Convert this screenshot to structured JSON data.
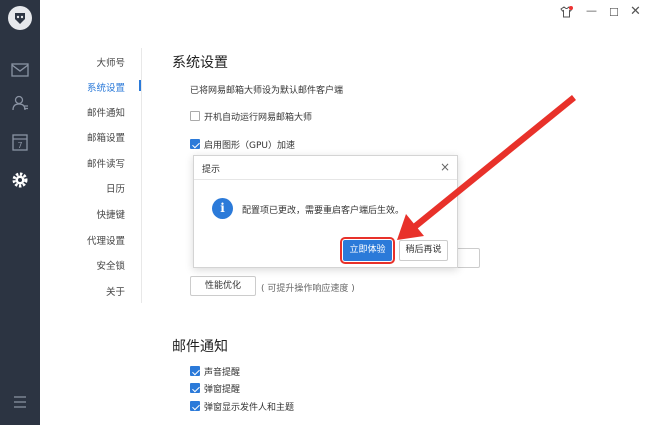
{
  "window_controls": {
    "skin_icon": "shirt-icon",
    "min_label": "—",
    "max_label": "☐",
    "close_label": "✕"
  },
  "sidebar": {
    "icons": [
      "logo-icon",
      "mail-icon",
      "contacts-icon",
      "calendar-icon",
      "settings-icon",
      "menu-icon"
    ],
    "calendar_number": "7"
  },
  "settings_nav": {
    "items": [
      {
        "label": "大师号",
        "active": false
      },
      {
        "label": "系统设置",
        "active": true
      },
      {
        "label": "邮件通知",
        "active": false
      },
      {
        "label": "邮箱设置",
        "active": false
      },
      {
        "label": "邮件读写",
        "active": false
      },
      {
        "label": "日历",
        "active": false
      },
      {
        "label": "快捷键",
        "active": false
      },
      {
        "label": "代理设置",
        "active": false
      },
      {
        "label": "安全锁",
        "active": false
      },
      {
        "label": "关于",
        "active": false
      }
    ]
  },
  "system_settings": {
    "title": "系统设置",
    "default_client_text": "已将网易邮箱大师设为默认邮件客户端",
    "autostart_label": "开机自动运行网易邮箱大师",
    "autostart_checked": false,
    "gpu_label": "启用图形（GPU）加速",
    "gpu_checked": true,
    "perf_button": "性能优化",
    "perf_hint": "( 可提升操作响应速度 )"
  },
  "mail_notification": {
    "title": "邮件通知",
    "options": [
      {
        "label": "声音提醒",
        "checked": true
      },
      {
        "label": "弹窗提醒",
        "checked": true
      },
      {
        "label": "弹窗显示发件人和主题",
        "checked": true
      }
    ]
  },
  "dialog": {
    "title": "提示",
    "close_label": "×",
    "info_icon": "i",
    "message": "配置项已更改，需要重启客户端后生效。",
    "primary_button": "立即体验",
    "secondary_button": "稍后再说"
  },
  "colors": {
    "accent": "#2b7ad9",
    "sidebar_bg": "#2c3442",
    "annotation_red": "#e8312a"
  }
}
